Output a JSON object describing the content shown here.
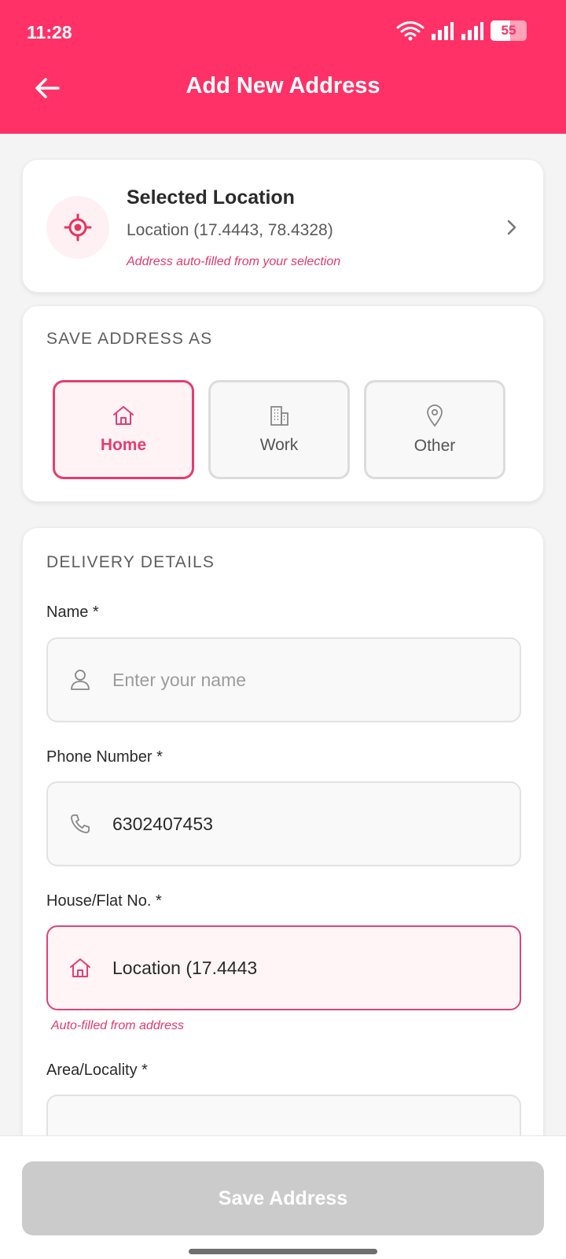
{
  "status_bar": {
    "time": "11:28",
    "battery": "55",
    "battery_level": 0.55
  },
  "header": {
    "title": "Add New Address",
    "back_icon": "arrow-left-icon"
  },
  "selected_location": {
    "title": "Selected Location",
    "coordinates": "Location (17.4443, 78.4328)",
    "note": "Address auto-filled from your selection"
  },
  "save_as": {
    "section_title": "SAVE ADDRESS AS",
    "options": [
      {
        "label": "Home",
        "icon": "home-icon",
        "selected": true
      },
      {
        "label": "Work",
        "icon": "building-icon",
        "selected": false
      },
      {
        "label": "Other",
        "icon": "map-pin-icon",
        "selected": false
      }
    ]
  },
  "delivery": {
    "section_title": "DELIVERY DETAILS",
    "name": {
      "label": "Name *",
      "placeholder": "Enter your name",
      "value": ""
    },
    "phone": {
      "label": "Phone Number *",
      "value": "6302407453"
    },
    "house": {
      "label": "House/Flat No. *",
      "value": "Location (17.4443",
      "note": "Auto-filled from address"
    },
    "area": {
      "label": "Area/Locality *",
      "value": ""
    }
  },
  "footer": {
    "save_label": "Save Address"
  },
  "colors": {
    "accent": "#ff3166",
    "accent_text": "#e63d6e",
    "disabled_button": "#cbcbcb"
  }
}
